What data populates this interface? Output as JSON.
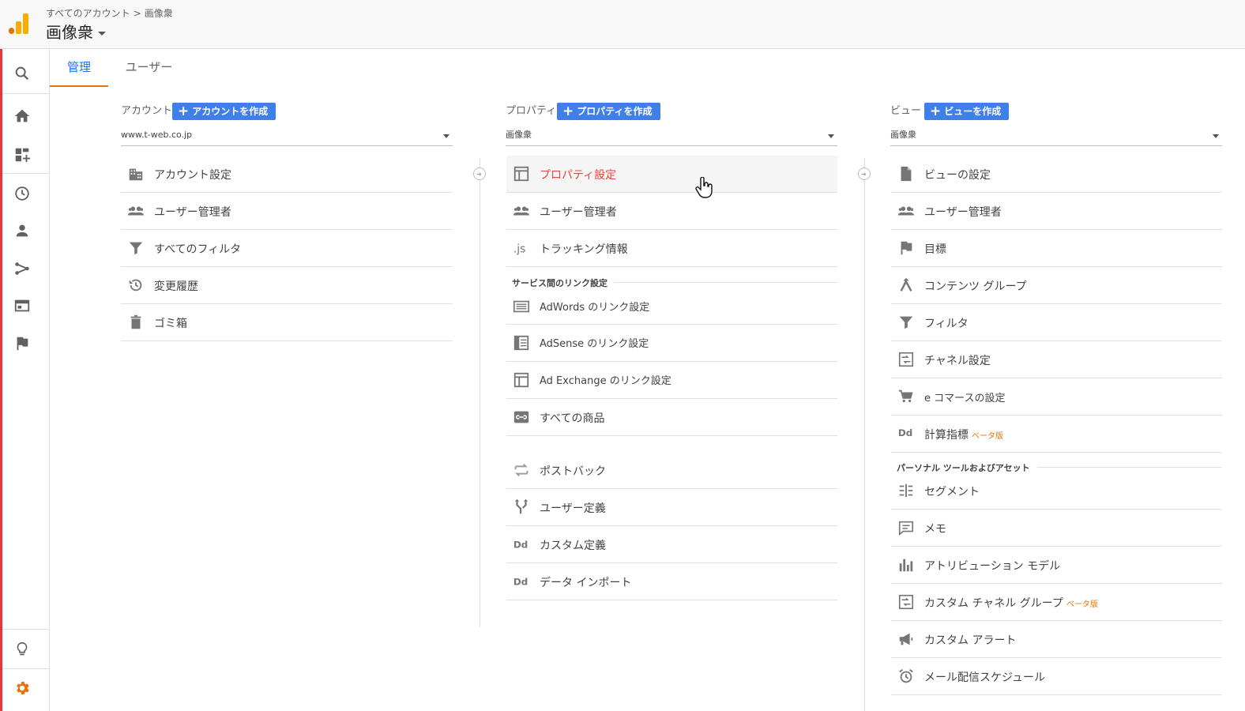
{
  "header": {
    "breadcrumb_root": "すべてのアカウント",
    "breadcrumb_sep": ">",
    "breadcrumb_current": "画像衆",
    "title": "画像衆"
  },
  "leftnav": {
    "items": [
      "search-icon",
      "home-icon",
      "dashboard-icon",
      "clock-icon",
      "person-icon",
      "share-icon",
      "browser-icon",
      "flag-icon"
    ],
    "bottom": [
      "lightbulb-icon",
      "gear-icon"
    ],
    "accent": "#e8710a"
  },
  "tabs": [
    {
      "label": "管理",
      "active": true
    },
    {
      "label": "ユーザー",
      "active": false
    }
  ],
  "account": {
    "heading": "アカウント",
    "create_label": "アカウントを作成",
    "selected": "www.t-web.co.jp",
    "items": [
      {
        "label": "アカウント設定",
        "icon": "building-icon"
      },
      {
        "label": "ユーザー管理者",
        "icon": "people-icon"
      },
      {
        "label": "すべてのフィルタ",
        "icon": "filter-icon"
      },
      {
        "label": "変更履歴",
        "icon": "history-icon"
      },
      {
        "label": "ゴミ箱",
        "icon": "trash-icon"
      }
    ]
  },
  "property": {
    "heading": "プロパティ",
    "create_label": "プロパティを作成",
    "selected": "画像衆",
    "items": [
      {
        "label": "プロパティ設定",
        "icon": "layout-icon"
      },
      {
        "label": "ユーザー管理者",
        "icon": "people-icon"
      },
      {
        "label": "トラッキング情報",
        "icon": "js-icon"
      }
    ],
    "links_section": "サービス間のリンク設定",
    "link_items": [
      {
        "label": "AdWords のリンク設定",
        "icon": "adwords-icon"
      },
      {
        "label": "AdSense のリンク設定",
        "icon": "adsense-icon"
      },
      {
        "label": "Ad Exchange のリンク設定",
        "icon": "layout-icon"
      },
      {
        "label": "すべての商品",
        "icon": "link-icon"
      }
    ],
    "other_items": [
      {
        "label": "ポストバック",
        "icon": "postback-icon"
      },
      {
        "label": "ユーザー定義",
        "icon": "fork-icon"
      },
      {
        "label": "カスタム定義",
        "icon": "dd-icon"
      },
      {
        "label": "データ インポート",
        "icon": "dd-icon"
      }
    ]
  },
  "view": {
    "heading": "ビュー",
    "create_label": "ビューを作成",
    "selected": "画像衆",
    "items": [
      {
        "label": "ビューの設定",
        "icon": "document-icon"
      },
      {
        "label": "ユーザー管理者",
        "icon": "people-icon"
      },
      {
        "label": "目標",
        "icon": "flag-icon"
      },
      {
        "label": "コンテンツ グループ",
        "icon": "content-group-icon"
      },
      {
        "label": "フィルタ",
        "icon": "filter-icon"
      },
      {
        "label": "チャネル設定",
        "icon": "channel-icon"
      },
      {
        "label": "e コマースの設定",
        "icon": "cart-icon"
      },
      {
        "label": "計算指標",
        "icon": "dd-icon",
        "badge": "ベータ版"
      }
    ],
    "personal_section": "パーソナル ツールおよびアセット",
    "personal_items": [
      {
        "label": "セグメント",
        "icon": "segment-icon"
      },
      {
        "label": "メモ",
        "icon": "comment-icon"
      },
      {
        "label": "アトリビューション モデル",
        "icon": "bar-chart-icon"
      },
      {
        "label": "カスタム チャネル グループ",
        "icon": "channel-icon",
        "badge": "ベータ版"
      },
      {
        "label": "カスタム アラート",
        "icon": "megaphone-icon"
      },
      {
        "label": "メール配信スケジュール",
        "icon": "alarm-icon"
      }
    ]
  }
}
